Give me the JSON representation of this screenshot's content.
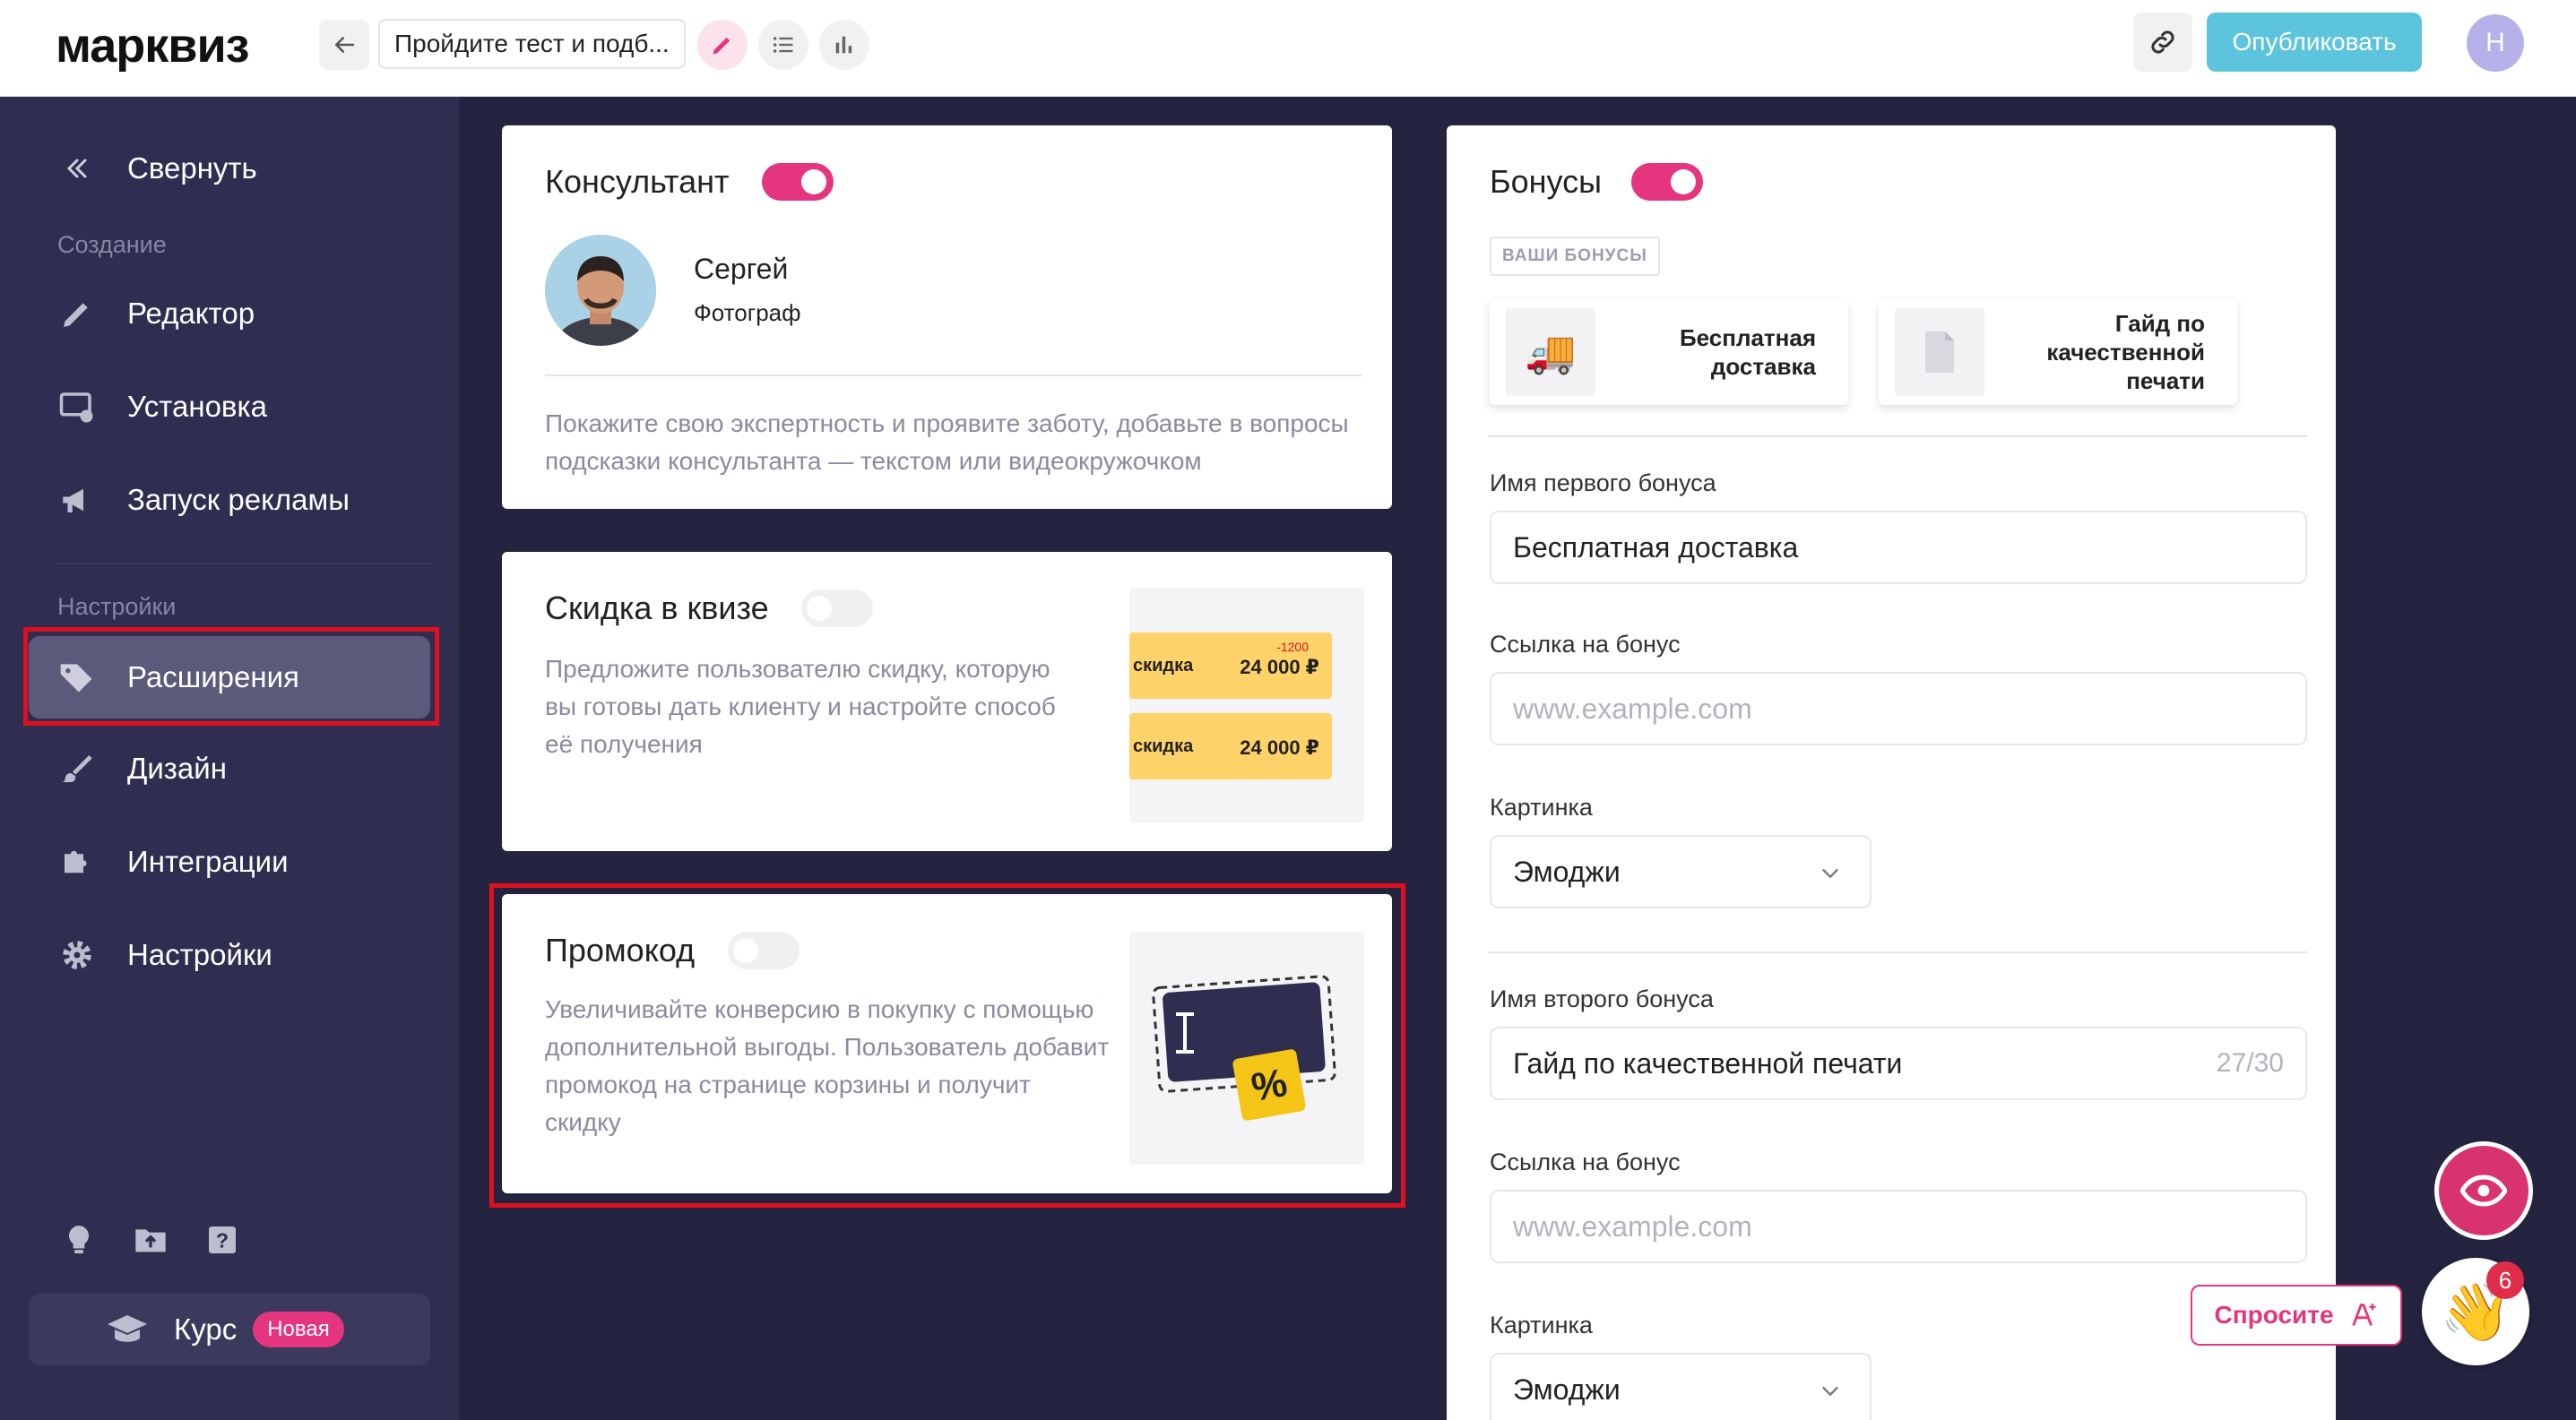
{
  "app": {
    "logo": "марквиз"
  },
  "topbar": {
    "quiz_title": "Пройдите тест и подб...",
    "publish_label": "Опубликовать",
    "avatar_initial": "Н"
  },
  "sidebar": {
    "collapse_label": "Свернуть",
    "section_create": "Создание",
    "section_settings": "Настройки",
    "items": {
      "editor": "Редактор",
      "install": "Установка",
      "ads": "Запуск рекламы",
      "extensions": "Расширения",
      "design": "Дизайн",
      "integrations": "Интеграции",
      "settings": "Настройки"
    },
    "course_label": "Курс",
    "course_badge": "Новая"
  },
  "consultant": {
    "title": "Консультант",
    "enabled": true,
    "name": "Сергей",
    "role": "Фотограф",
    "description": "Покажите свою экспертность и проявите заботу, добавьте в вопросы подсказки консультанта — текстом или видеокружочком"
  },
  "discount": {
    "title": "Скидка в квизе",
    "enabled": false,
    "description": "Предложите пользователю скидку, которую вы готовы дать клиенту и настройте способ её получения",
    "preview": {
      "label": "скидка",
      "price": "24 000 ₽",
      "old_delta": "-1200"
    }
  },
  "promo": {
    "title": "Промокод",
    "enabled": false,
    "description": "Увеличивайте конверсию в покупку с помощью дополнительной выгоды. Пользователь добавит промокод на странице корзины и получит скидку",
    "preview_symbol": "%"
  },
  "bonuses": {
    "title": "Бонусы",
    "enabled": true,
    "your_bonuses_label": "ВАШИ БОНУСЫ",
    "cards": [
      {
        "icon": "truck-emoji",
        "name": "Бесплатная доставка"
      },
      {
        "icon": "document-emoji",
        "name": "Гайд по качественной печати"
      }
    ],
    "first": {
      "name_label": "Имя первого бонуса",
      "name_value": "Бесплатная доставка",
      "link_label": "Ссылка на бонус",
      "link_placeholder": "www.example.com",
      "image_label": "Картинка",
      "image_value": "Эмоджи"
    },
    "second": {
      "name_label": "Имя второго бонуса",
      "name_value": "Гайд по качественной печати",
      "name_counter": "27/30",
      "link_label": "Ссылка на бонус",
      "link_placeholder": "www.example.com",
      "image_label": "Картинка",
      "image_value": "Эмоджи"
    }
  },
  "help": {
    "ask_label": "Спросите",
    "notifications": "6"
  },
  "colors": {
    "accent_pink": "#e5357f",
    "publish_blue": "#5cc4dd",
    "sidebar_bg": "#2f2e50",
    "page_bg": "#242340",
    "highlight_red": "#e0101e"
  }
}
